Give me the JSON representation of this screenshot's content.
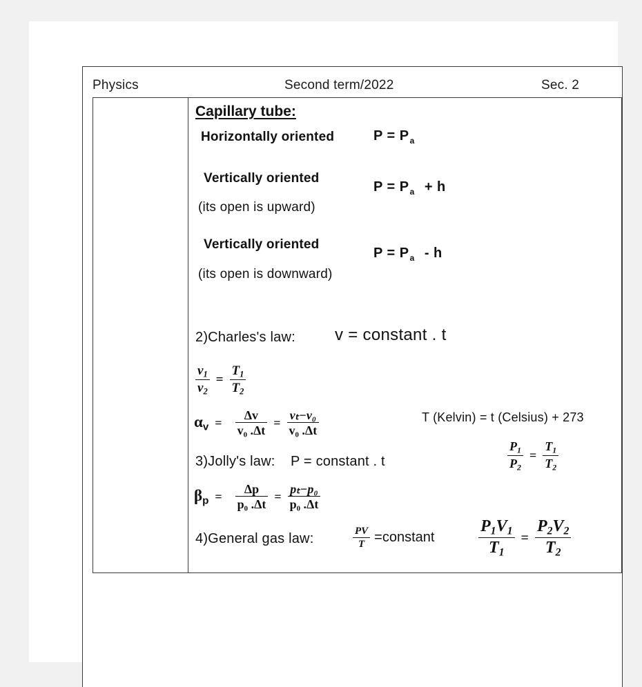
{
  "header": {
    "subject": "Physics",
    "term": "Second term/2022",
    "section": "Sec. 2"
  },
  "capillary": {
    "heading": "Capillary tube:",
    "rows": [
      {
        "label": "Horizontally oriented",
        "sub_label": "",
        "eq_lhs": "P = P",
        "eq_sub": "a",
        "eq_rhs": ""
      },
      {
        "label": "Vertically oriented",
        "sub_label": "(its open is upward)",
        "eq_lhs": "P = P",
        "eq_sub": "a",
        "eq_rhs": "+ h"
      },
      {
        "label": "Vertically oriented",
        "sub_label": "(its open is downward)",
        "eq_lhs": "P = P",
        "eq_sub": "a",
        "eq_rhs": "- h"
      }
    ]
  },
  "laws": {
    "charles": {
      "title": "2)Charles's law:",
      "statement": "v = constant . t",
      "ratio": {
        "n1": "v",
        "n1s": "1",
        "d1": "v",
        "d1s": "2",
        "n2": "T",
        "n2s": "1",
        "d2": "T",
        "d2s": "2",
        "op": "="
      },
      "coefficient": {
        "symbol": "α",
        "symbol_sub": "v",
        "equals": "=",
        "f1_num": "Δv",
        "f1_den": "v₀ .Δt",
        "mid_op": "=",
        "f2_num": "vₜ−v₀",
        "f2_den": "v₀ .Δt"
      }
    },
    "jolly": {
      "title": "3)Jolly's law:",
      "statement": "P = constant . t",
      "coefficient": {
        "symbol": "β",
        "symbol_sub": "p",
        "equals": "=",
        "f1_num": "Δp",
        "f1_den": "p₀ .Δt",
        "mid_op": "=",
        "f2_num": "pₜ−p₀",
        "f2_den": "p₀ .Δt"
      }
    },
    "general": {
      "title": "4)General gas law:",
      "frac_num": "PV",
      "frac_den": "T",
      "statement": "=constant"
    }
  },
  "right_column": {
    "kelvin": "T (Kelvin) = t (Celsius) + 273",
    "pressure_ratio": {
      "n1": "P",
      "n1s": "1",
      "d1": "P",
      "d1s": "2",
      "op": "=",
      "n2": "T",
      "n2s": "1",
      "d2": "T",
      "d2s": "2"
    },
    "combined": {
      "n1": "P",
      "n1s": "1",
      "n1b": "V",
      "n1bs": "1",
      "d1": "T",
      "d1s": "1",
      "op": "=",
      "n2": "P",
      "n2s": "2",
      "n2b": "V",
      "n2bs": "2",
      "d2": "T",
      "d2s": "2"
    }
  },
  "colors": {
    "page": "#ffffff",
    "backdrop": "#f1f1f1",
    "ink": "#111111",
    "rule": "#3a3a3a"
  }
}
